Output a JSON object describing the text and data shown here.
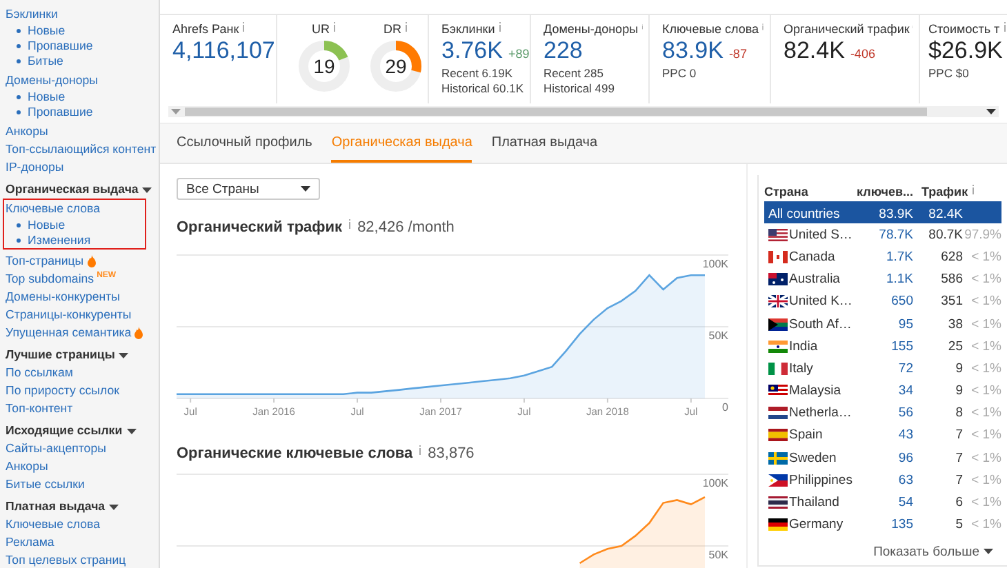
{
  "sidebar": {
    "sections": [
      {
        "items": [
          {
            "label": "Бэклинки",
            "children": [
              {
                "label": "Новые"
              },
              {
                "label": "Пропавшие"
              },
              {
                "label": "Битые"
              }
            ]
          },
          {
            "label": "Домены-доноры",
            "children": [
              {
                "label": "Новые"
              },
              {
                "label": "Пропавшие"
              }
            ]
          },
          {
            "label": "Анкоры"
          },
          {
            "label": "Топ-ссылающийся контент"
          },
          {
            "label": "IP-доноры"
          }
        ]
      },
      {
        "heading": "Органическая выдача",
        "items": [
          {
            "label": "Ключевые слова",
            "highlighted": true,
            "children": [
              {
                "label": "Новые"
              },
              {
                "label": "Изменения"
              }
            ]
          },
          {
            "label": "Топ-страницы",
            "hot": true
          },
          {
            "label": "Top subdomains",
            "badge": "NEW"
          },
          {
            "label": "Домены-конкуренты"
          },
          {
            "label": "Страницы-конкуренты"
          },
          {
            "label": "Упущенная семантика",
            "hot": true
          }
        ]
      },
      {
        "heading": "Лучшие страницы",
        "items": [
          {
            "label": "По ссылкам"
          },
          {
            "label": "По приросту ссылок"
          },
          {
            "label": "Топ-контент"
          }
        ]
      },
      {
        "heading": "Исходящие ссылки",
        "items": [
          {
            "label": "Сайты-акцепторы"
          },
          {
            "label": "Анкоры"
          },
          {
            "label": "Битые ссылки"
          }
        ]
      },
      {
        "heading": "Платная выдача",
        "items": [
          {
            "label": "Ключевые слова"
          },
          {
            "label": "Реклама"
          },
          {
            "label": "Топ целевых страниц"
          }
        ]
      }
    ]
  },
  "metrics": [
    {
      "kind": "plain",
      "label": "Ahrefs Ранк",
      "value": "4,116,107",
      "link": true
    },
    {
      "kind": "gauges",
      "gauges": [
        {
          "label": "UR",
          "value": "19",
          "level": 0.19,
          "color": "#8cc152"
        },
        {
          "label": "DR",
          "value": "29",
          "level": 0.29,
          "color": "#ff7a00"
        }
      ]
    },
    {
      "kind": "plain",
      "label": "Бэклинки",
      "value": "3.76K",
      "link": true,
      "delta": {
        "text": "+89",
        "color": "#5b9a6a"
      },
      "notes": [
        "Recent 6.19K",
        "Historical 60.1K"
      ]
    },
    {
      "kind": "plain",
      "label": "Домены-доноры",
      "value": "228",
      "link": true,
      "notes": [
        "Recent 285",
        "Historical 499"
      ]
    },
    {
      "kind": "plain",
      "label": "Ключевые слова",
      "value": "83.9K",
      "link": true,
      "delta": {
        "text": "-87",
        "color": "#c0392b"
      },
      "notes": [
        "PPC 0"
      ]
    },
    {
      "kind": "plain",
      "label": "Органический трафик",
      "value": "82.4K",
      "link": false,
      "delta": {
        "text": "-406",
        "color": "#c0392b"
      }
    },
    {
      "kind": "plain",
      "label": "Стоимость т",
      "value": "$26.9K",
      "link": false,
      "notes": [
        "PPC $0"
      ]
    }
  ],
  "tabs": [
    {
      "label": "Ссылочный профиль",
      "selected": false
    },
    {
      "label": "Органическая выдача",
      "selected": true
    },
    {
      "label": "Платная выдача",
      "selected": false
    }
  ],
  "country_select": {
    "value": "Все Страны"
  },
  "charts": [
    {
      "title": "Органический трафик",
      "summary": "82,426 /month",
      "chart_data": {
        "type": "area",
        "categories": [
          null,
          "Jul",
          null,
          null,
          null,
          null,
          null,
          "Jan 2016",
          null,
          null,
          null,
          null,
          null,
          "Jul",
          null,
          null,
          null,
          null,
          null,
          "Jan 2017",
          null,
          null,
          null,
          null,
          null,
          "Jul",
          null,
          null,
          null,
          null,
          null,
          "Jan 2018",
          null,
          null,
          null,
          null,
          null,
          "Jul",
          null
        ],
        "series": [
          {
            "color": "#5ba4e0",
            "values": [
              3000,
              3000,
              3000,
              3000,
              3000,
              3000,
              3000,
              3000,
              3000,
              3000,
              3000,
              3000,
              3000,
              4000,
              4000,
              5000,
              6000,
              7000,
              8000,
              9000,
              10000,
              11000,
              12000,
              13000,
              14000,
              16000,
              19000,
              22000,
              33000,
              45000,
              55000,
              63000,
              68000,
              75000,
              86000,
              76000,
              84000,
              86000,
              86000
            ]
          }
        ],
        "ylim": [
          0,
          100000
        ],
        "yticks": [
          {
            "value": 0,
            "label": "0"
          },
          {
            "value": 50000,
            "label": "50K"
          },
          {
            "value": 100000,
            "label": "100K"
          }
        ]
      }
    },
    {
      "title": "Органические ключевые слова",
      "summary": "83,876",
      "chart_data": {
        "type": "area",
        "series": [
          {
            "color": "#ff8a1c",
            "values": [
              null,
              null,
              null,
              null,
              null,
              null,
              null,
              null,
              null,
              null,
              null,
              null,
              null,
              null,
              null,
              null,
              null,
              null,
              null,
              null,
              null,
              null,
              null,
              null,
              null,
              null,
              null,
              null,
              null,
              38000,
              44000,
              48000,
              50000,
              57000,
              66000,
              80000,
              82000,
              79000,
              84000
            ]
          }
        ],
        "ylim": [
          0,
          100000
        ],
        "yticks": [
          {
            "value": 50000,
            "label": "50K"
          },
          {
            "value": 100000,
            "label": "100K"
          }
        ]
      }
    }
  ],
  "countries": {
    "columns": [
      "Страна",
      "ключев...",
      "Трафик"
    ],
    "rows": [
      {
        "name": "All countries",
        "keywords": "83.9K",
        "traffic": "82.4K",
        "selected": true
      },
      {
        "name": "United S…",
        "keywords": "78.7K",
        "traffic": "80.7K",
        "share": "97.9%",
        "selected": false
      },
      {
        "name": "Canada",
        "keywords": "1.7K",
        "traffic": "628",
        "share": "< 1%",
        "selected": false
      },
      {
        "name": "Australia",
        "keywords": "1.1K",
        "traffic": "586",
        "share": "< 1%",
        "selected": false
      },
      {
        "name": "United K…",
        "keywords": "650",
        "traffic": "351",
        "share": "< 1%",
        "selected": false
      },
      {
        "name": "South Af…",
        "keywords": "95",
        "traffic": "38",
        "share": "< 1%",
        "selected": false
      },
      {
        "name": "India",
        "keywords": "155",
        "traffic": "25",
        "share": "< 1%",
        "selected": false
      },
      {
        "name": "Italy",
        "keywords": "72",
        "traffic": "9",
        "share": "< 1%",
        "selected": false
      },
      {
        "name": "Malaysia",
        "keywords": "34",
        "traffic": "9",
        "share": "< 1%",
        "selected": false
      },
      {
        "name": "Netherla…",
        "keywords": "56",
        "traffic": "8",
        "share": "< 1%",
        "selected": false
      },
      {
        "name": "Spain",
        "keywords": "43",
        "traffic": "7",
        "share": "< 1%",
        "selected": false
      },
      {
        "name": "Sweden",
        "keywords": "96",
        "traffic": "7",
        "share": "< 1%",
        "selected": false
      },
      {
        "name": "Philippines",
        "keywords": "63",
        "traffic": "7",
        "share": "< 1%",
        "selected": false
      },
      {
        "name": "Thailand",
        "keywords": "54",
        "traffic": "6",
        "share": "< 1%",
        "selected": false
      },
      {
        "name": "Germany",
        "keywords": "135",
        "traffic": "5",
        "share": "< 1%",
        "selected": false
      }
    ],
    "more": "Показать больше"
  }
}
